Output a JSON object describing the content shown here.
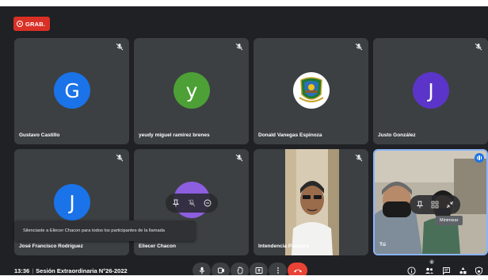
{
  "recording": {
    "label": "GRAB."
  },
  "participants": [
    {
      "name": "Gustavo Castillo",
      "initial": "G",
      "color": "#1a73e8"
    },
    {
      "name": "yeudy miguel ramirez brenes",
      "initial": "y",
      "color": "#4da035"
    },
    {
      "name": "Donald Vanegas Espinoza",
      "initial": "",
      "color": "#ffffff"
    },
    {
      "name": "Justo González",
      "initial": "J",
      "color": "#5b35c9"
    },
    {
      "name": "José Francisco Rodríguez",
      "initial": "J",
      "color": "#1a73e8"
    },
    {
      "name": "Eliecer Chacon",
      "initial": "",
      "color": "#8e5ee0"
    },
    {
      "name": "Intendencia Paquera",
      "initial": ""
    },
    {
      "name": "Tú",
      "initial": ""
    }
  ],
  "toast": {
    "text": "Silenciaste a Eliecer Chacon para todos los participantes de la llamada"
  },
  "tooltip": {
    "text": "Minimizar"
  },
  "meeting": {
    "time": "13:36",
    "separator": "|",
    "title": "Sesión Extraordinaria N°26-2022"
  },
  "people_count": "8",
  "accent": "#8ab4f8",
  "end_call_color": "#ea4335"
}
